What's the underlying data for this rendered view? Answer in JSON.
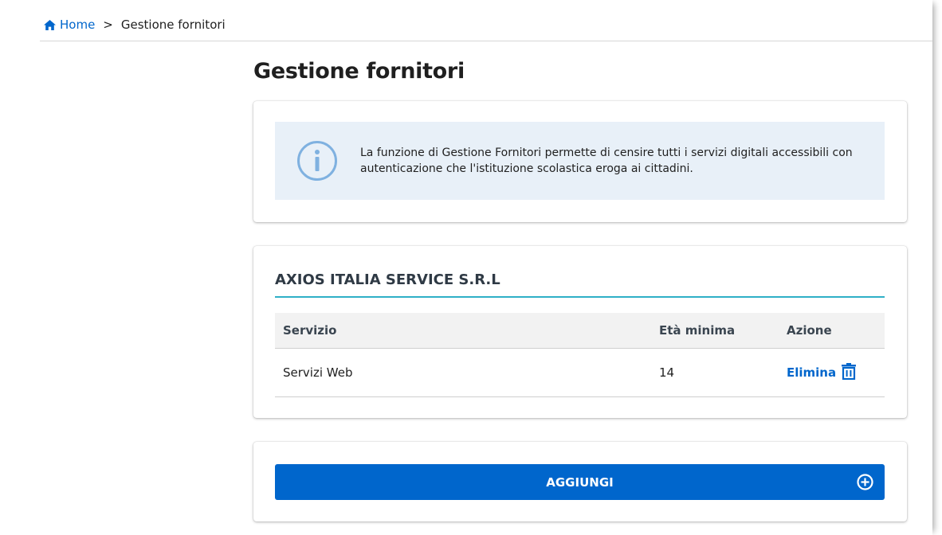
{
  "breadcrumb": {
    "home_label": "Home",
    "separator": ">",
    "current": "Gestione fornitori"
  },
  "page": {
    "title": "Gestione fornitori"
  },
  "info": {
    "icon": "info-icon",
    "text": "La funzione di Gestione Fornitori permette di censire tutti i servizi digitali accessibili con autenticazione che l'istituzione scolastica eroga ai cittadini."
  },
  "supplier": {
    "name": "AXIOS ITALIA SERVICE S.R.L",
    "table": {
      "headers": [
        "Servizio",
        "Età minima",
        "Azione"
      ],
      "rows": [
        {
          "service": "Servizi Web",
          "min_age": "14",
          "action": "Elimina"
        }
      ]
    }
  },
  "actions": {
    "add_label": "AGGIUNGI"
  },
  "colors": {
    "primary": "#0066cc",
    "accent_rule": "#2fb0c7",
    "info_bg": "#e8f0f8"
  }
}
